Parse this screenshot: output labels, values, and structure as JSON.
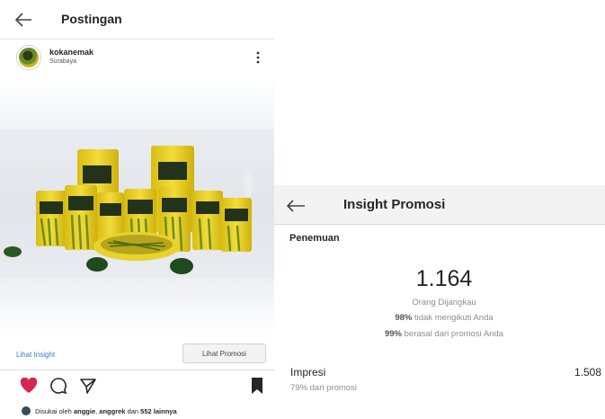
{
  "post": {
    "header_title": "Postingan",
    "username": "kokanemak",
    "location": "Surabaya",
    "lihat_insight": "Lihat Insight",
    "lihat_promosi": "Lihat Promosi",
    "likes": {
      "prefix": "Disukai oleh ",
      "user1": "anggie",
      "sep": ", ",
      "user2": "anggrek",
      "mid": " dan ",
      "others": "552 lainnya"
    },
    "icons": [
      "back-arrow-icon",
      "more-vertical-icon",
      "heart-icon",
      "comment-icon",
      "share-icon",
      "bookmark-icon"
    ],
    "colors": {
      "heart": "#d6264b",
      "link": "#3c79c7",
      "product_yellow": "#e9cf22"
    }
  },
  "insight": {
    "header_title": "Insight Promosi",
    "section_title": "Penemuan",
    "reach_value": "1.164",
    "reach_label": "Orang Dijangkau",
    "line1_bold": "98%",
    "line1_text": " tidak mengikuti Anda",
    "line2_bold": "99%",
    "line2_text": " berasal dari promosi Anda",
    "impresi_label": "Impresi",
    "impresi_value": "1.508",
    "impresi_sub": "79% dari promosi"
  }
}
